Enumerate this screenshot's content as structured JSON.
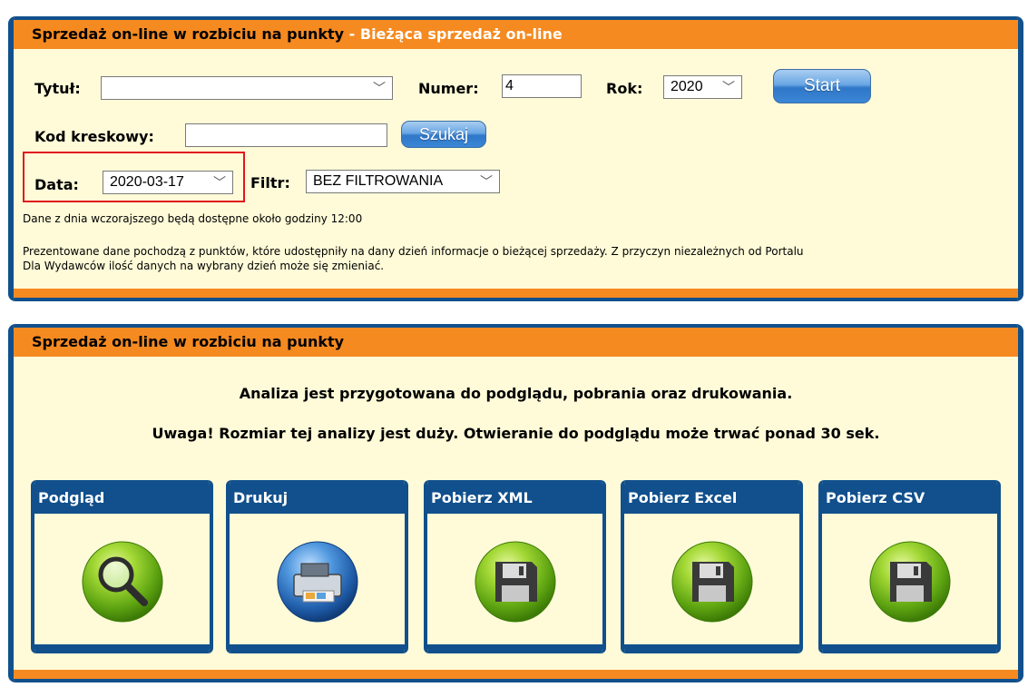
{
  "panel1": {
    "title": "Sprzedaż on-line w rozbiciu na punkty",
    "separator": " - ",
    "subtitle": "Bieżąca sprzedaż on-line",
    "tytul_label": "Tytuł:",
    "tytul_value": "",
    "numer_label": "Numer:",
    "numer_value": "4",
    "rok_label": "Rok:",
    "rok_value": "2020",
    "start_label": "Start",
    "kod_label": "Kod kreskowy:",
    "kod_value": "",
    "szukaj_label": "Szukaj",
    "data_label": "Data:",
    "data_value": "2020-03-17",
    "filtr_label": "Filtr:",
    "filtr_value": "BEZ FILTROWANIA",
    "note1": "Dane z dnia wczorajszego będą dostępne około godziny 12:00",
    "note2_line1": "Prezentowane dane pochodzą z punktów, które udostępniły na dany dzień informacje o bieżącej sprzedaży. Z przyczyn niezależnych od Portalu",
    "note2_line2": "Dla Wydawców ilość danych na wybrany dzień może się zmieniać."
  },
  "panel2": {
    "title": "Sprzedaż on-line w rozbiciu na punkty",
    "message1": "Analiza jest przygotowana do podglądu, pobrania oraz drukowania.",
    "message2": "Uwaga! Rozmiar tej analizy jest duży. Otwieranie do podglądu może trwać ponad 30 sek.",
    "actions": [
      {
        "label": "Podgląd",
        "icon": "magnifier-icon"
      },
      {
        "label": "Drukuj",
        "icon": "printer-icon"
      },
      {
        "label": "Pobierz XML",
        "icon": "floppy-disk-icon"
      },
      {
        "label": "Pobierz Excel",
        "icon": "floppy-disk-icon"
      },
      {
        "label": "Pobierz CSV",
        "icon": "floppy-disk-icon"
      }
    ]
  },
  "colors": {
    "header_orange": "#f58a21",
    "border_blue": "#11508c",
    "panel_bg": "#fffbd8",
    "highlight_red": "#e0171d",
    "icon_green": "#7cc21c"
  }
}
